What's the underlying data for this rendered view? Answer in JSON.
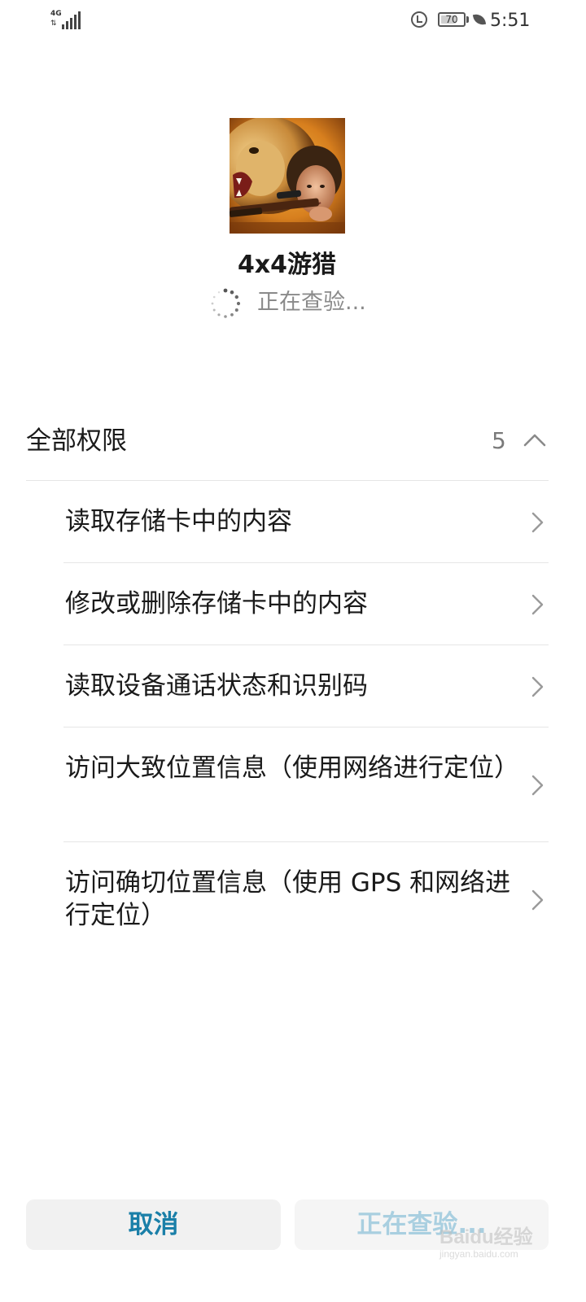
{
  "status_bar": {
    "network": "4G",
    "battery": "70",
    "time": "5:51",
    "icons": [
      "signal-icon",
      "sync-icon",
      "battery-icon",
      "leaf-icon"
    ]
  },
  "app": {
    "name": "4x4游猎",
    "status": "正在查验..."
  },
  "permissions": {
    "title": "全部权限",
    "count": "5",
    "items": [
      {
        "label": "读取存储卡中的内容"
      },
      {
        "label": "修改或删除存储卡中的内容"
      },
      {
        "label": "读取设备通话状态和识别码"
      },
      {
        "label": "访问大致位置信息（使用网络进行定位）"
      },
      {
        "label": "访问确切位置信息（使用 GPS 和网络进行定位）"
      }
    ]
  },
  "buttons": {
    "cancel": "取消",
    "install": "正在查验..."
  },
  "watermark": {
    "main": "Baidu经验",
    "url": "jingyan.baidu.com"
  },
  "colors": {
    "accent": "#1a7fa8",
    "disabled_accent": "#a9cfe0",
    "button_bg": "#f1f1f1",
    "divider": "#e6e6e6"
  }
}
